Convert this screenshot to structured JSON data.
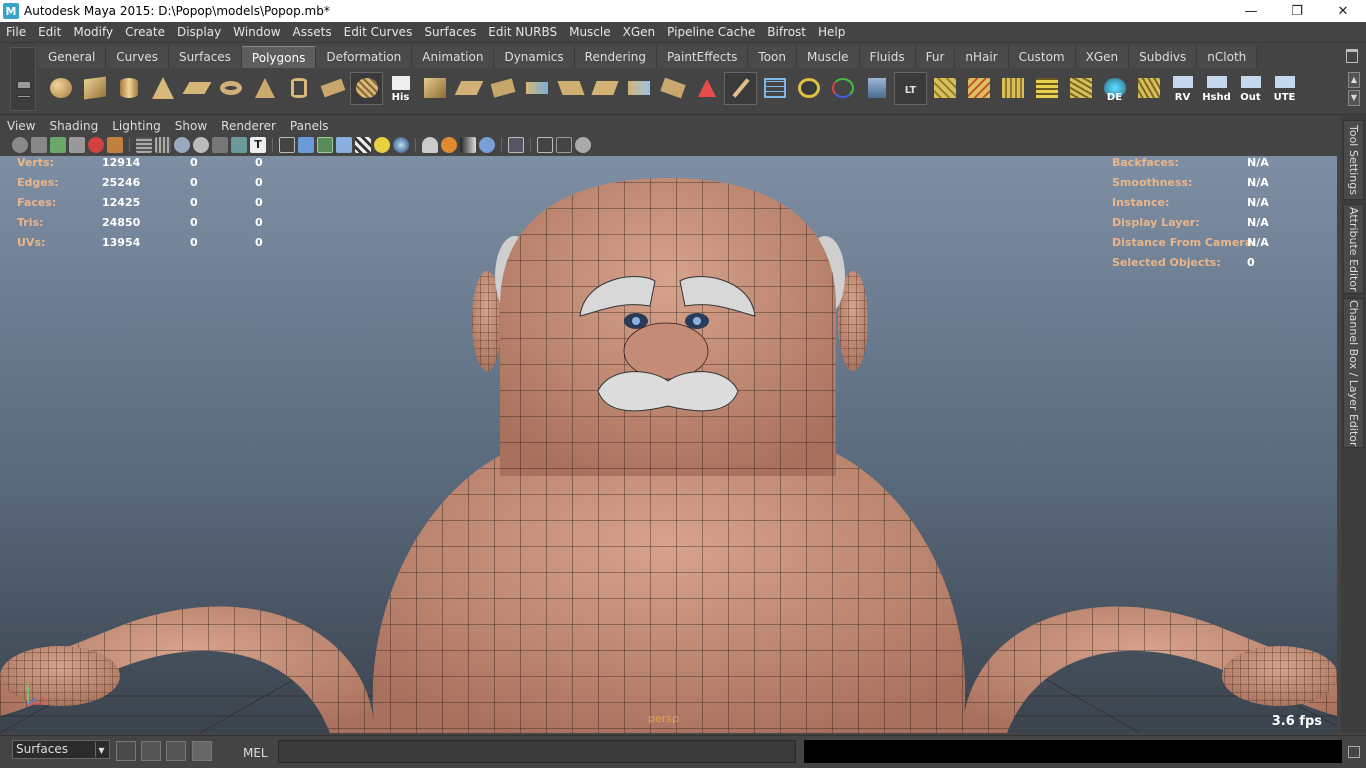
{
  "window": {
    "title": "Autodesk Maya 2015: D:\\Popop\\models\\Popop.mb*",
    "app_icon": "M"
  },
  "menubar": [
    "File",
    "Edit",
    "Modify",
    "Create",
    "Display",
    "Window",
    "Assets",
    "Edit Curves",
    "Surfaces",
    "Edit NURBS",
    "Muscle",
    "XGen",
    "Pipeline Cache",
    "Bifrost",
    "Help"
  ],
  "shelf": {
    "tabs": [
      "General",
      "Curves",
      "Surfaces",
      "Polygons",
      "Deformation",
      "Animation",
      "Dynamics",
      "Rendering",
      "PaintEffects",
      "Toon",
      "Muscle",
      "Fluids",
      "Fur",
      "nHair",
      "Custom",
      "XGen",
      "Subdivs",
      "nCloth"
    ],
    "active_tab": "Polygons",
    "icon_labels": {
      "his": "His",
      "lt": "LT",
      "de": "DE",
      "rv": "RV",
      "hshd": "Hshd",
      "out": "Out",
      "ute": "UTE"
    }
  },
  "viewport": {
    "menu": [
      "View",
      "Shading",
      "Lighting",
      "Show",
      "Renderer",
      "Panels"
    ],
    "hud_left": [
      {
        "label": "Verts:",
        "v1": "12914",
        "v2": "0",
        "v3": "0"
      },
      {
        "label": "Edges:",
        "v1": "25246",
        "v2": "0",
        "v3": "0"
      },
      {
        "label": "Faces:",
        "v1": "12425",
        "v2": "0",
        "v3": "0"
      },
      {
        "label": "Tris:",
        "v1": "24850",
        "v2": "0",
        "v3": "0"
      },
      {
        "label": "UVs:",
        "v1": "13954",
        "v2": "0",
        "v3": "0"
      }
    ],
    "hud_right": [
      {
        "label": "Backfaces:",
        "value": "N/A"
      },
      {
        "label": "Smoothness:",
        "value": "N/A"
      },
      {
        "label": "Instance:",
        "value": "N/A"
      },
      {
        "label": "Display Layer:",
        "value": "N/A"
      },
      {
        "label": "Distance From Camera:",
        "value": "N/A"
      },
      {
        "label": "Selected Objects:",
        "value": "0"
      }
    ],
    "fps": "3.6 fps",
    "camera": "persp",
    "axis_y": "y",
    "axis_x": "x"
  },
  "side_tabs": [
    "Tool Settings",
    "Attribute Editor",
    "Channel Box / Layer Editor"
  ],
  "statusbar": {
    "mode": "Surfaces",
    "script_lang": "MEL"
  }
}
